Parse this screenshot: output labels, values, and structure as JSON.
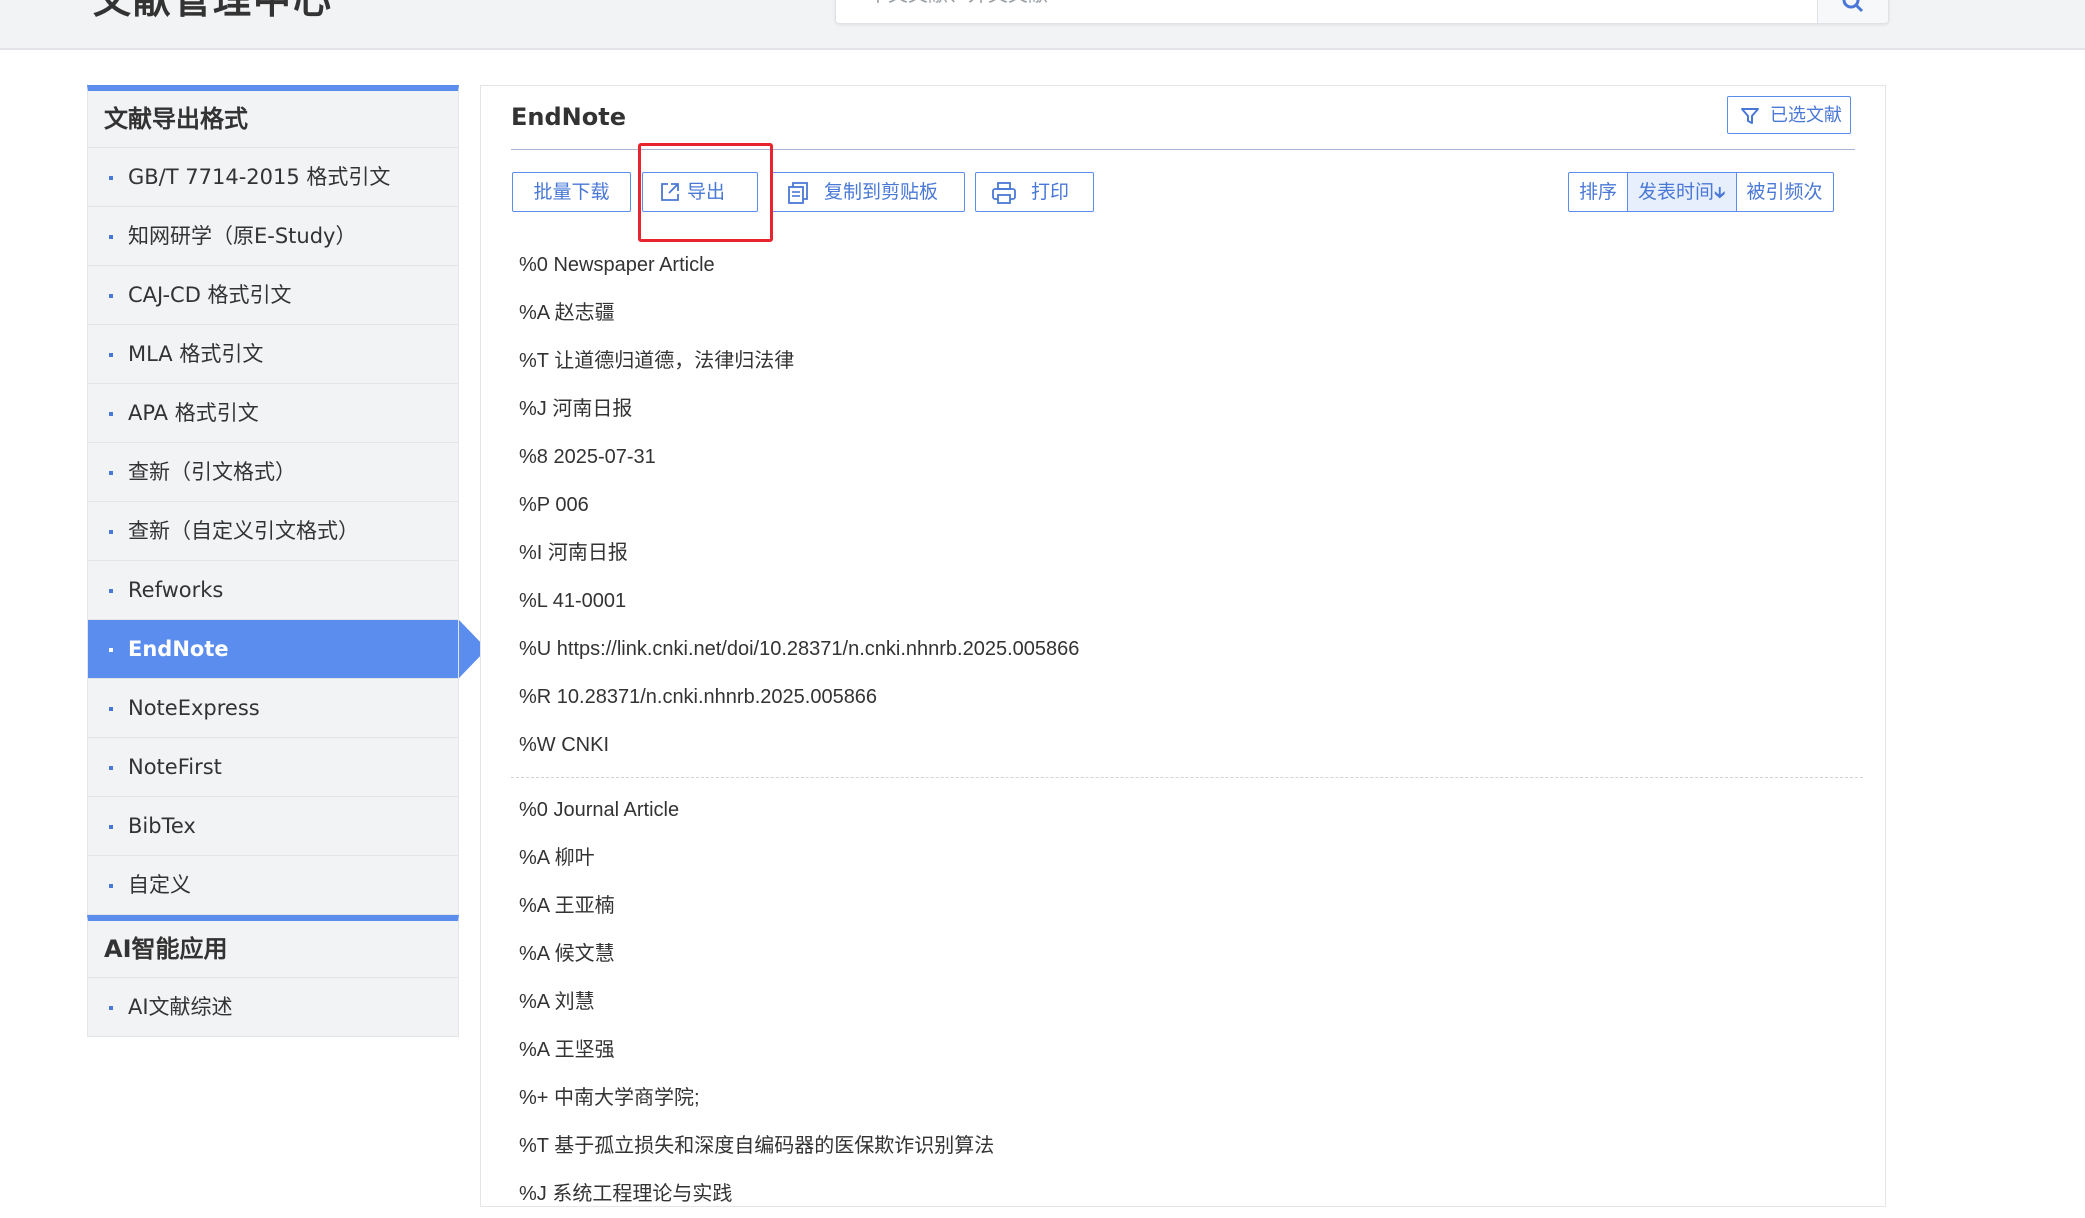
{
  "header": {
    "site_title": "文献管理中心",
    "search_placeholder": "中文文献、外文文献"
  },
  "sidebar": {
    "section1_title": "文献导出格式",
    "items": [
      {
        "label": "GB/T 7714-2015 格式引文"
      },
      {
        "label": "知网研学（原E-Study）"
      },
      {
        "label": "CAJ-CD 格式引文"
      },
      {
        "label": "MLA 格式引文"
      },
      {
        "label": "APA 格式引文"
      },
      {
        "label": "查新（引文格式）"
      },
      {
        "label": "查新（自定义引文格式）"
      },
      {
        "label": "Refworks"
      },
      {
        "label": "EndNote"
      },
      {
        "label": "NoteExpress"
      },
      {
        "label": "NoteFirst"
      },
      {
        "label": "BibTex"
      },
      {
        "label": "自定义"
      }
    ],
    "active_item": "EndNote",
    "section2_title": "AI智能应用",
    "section2_items": [
      {
        "label": "AI文献综述"
      }
    ]
  },
  "main": {
    "title": "EndNote",
    "selected_docs_label": "已选文献",
    "toolbar": {
      "batch_download": "批量下载",
      "export": "导出",
      "copy_clipboard": "复制到剪贴板",
      "print": "打印"
    },
    "sort": {
      "label": "排序",
      "pub_time": "发表时间",
      "cited": "被引频次"
    },
    "records": [
      [
        "%0 Newspaper Article",
        "%A 赵志疆",
        "%T 让道德归道德，法律归法律",
        "%J 河南日报",
        "%8 2025-07-31",
        "%P 006",
        "%I 河南日报",
        "%L 41-0001",
        "%U https://link.cnki.net/doi/10.28371/n.cnki.nhnrb.2025.005866",
        "%R 10.28371/n.cnki.nhnrb.2025.005866",
        "%W CNKI"
      ],
      [
        "%0 Journal Article",
        "%A 柳叶",
        "%A 王亚楠",
        "%A 候文慧",
        "%A 刘慧",
        "%A 王坚强",
        "%+ 中南大学商学院;",
        "%T 基于孤立损失和深度自编码器的医保欺诈识别算法",
        "%J 系统工程理论与实践"
      ]
    ]
  },
  "colors": {
    "accent": "#5b8def",
    "highlight": "#e8242c",
    "sidebar_bg": "#f2f3f5"
  }
}
